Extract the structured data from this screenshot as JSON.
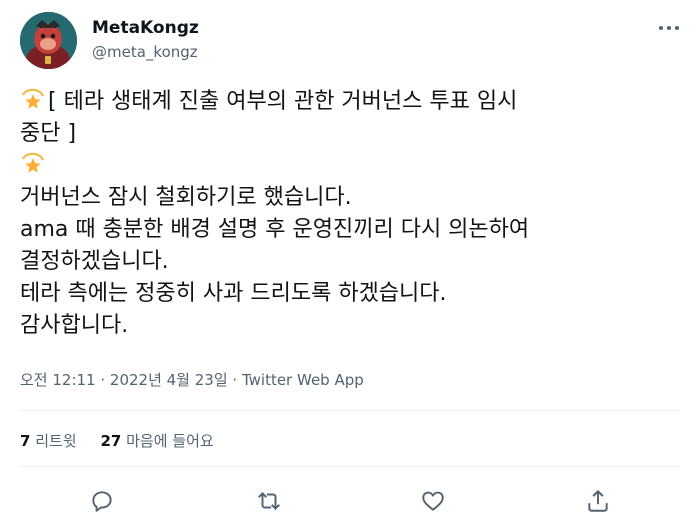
{
  "author": {
    "name": "MetaKongz",
    "handle": "@meta_kongz"
  },
  "tweet": {
    "line1": "[ 테라 생태계 진출 여부의 관한 거버넌스 투표 임시",
    "line2": "중단 ]",
    "line3": "거버넌스 잠시 철회하기로 했습니다.",
    "line4": "ama 때 충분한 배경 설명 후 운영진끼리 다시 의논하여",
    "line5": "결정하겠습니다.",
    "line6": "테라 측에는 정중히 사과 드리도록 하겠습니다.",
    "line7": "감사합니다."
  },
  "meta": {
    "datetime": "오전 12:11 · 2022년 4월 23일",
    "separator": " · ",
    "app": "Twitter Web App"
  },
  "stats": {
    "retweets_count": "7",
    "retweets_label": "리트윗",
    "likes_count": "27",
    "likes_label": "마음에 들어요"
  },
  "icons": {
    "more": "more-icon",
    "reply": "reply-icon",
    "retweet": "retweet-icon",
    "like": "like-icon",
    "share": "share-icon",
    "emoji": "dizzy-star-emoji"
  },
  "colors": {
    "text": "#0f1419",
    "secondary": "#536471",
    "divider": "#eff3f4"
  }
}
